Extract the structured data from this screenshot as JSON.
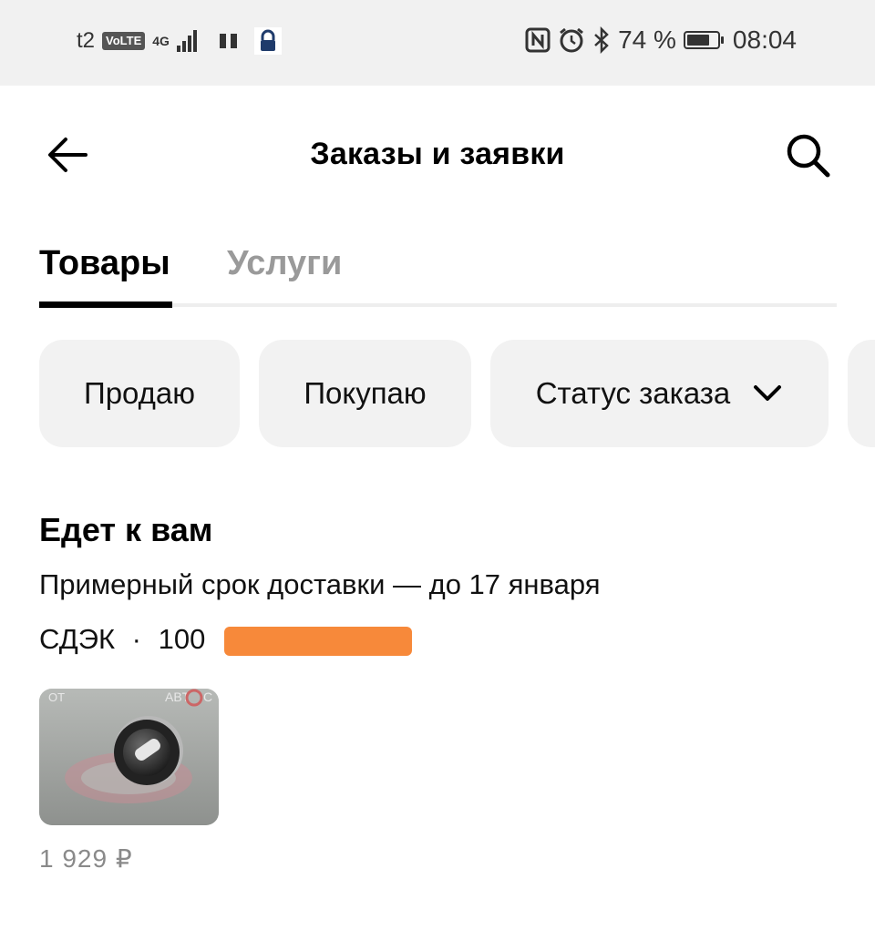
{
  "status_bar": {
    "carrier": "t2",
    "volte": "VoLTE",
    "network": "4G",
    "battery_percent": "74 %",
    "battery_level": 0.74,
    "time": "08:04"
  },
  "header": {
    "title": "Заказы и заявки"
  },
  "tabs": [
    {
      "label": "Товары",
      "active": true
    },
    {
      "label": "Услуги",
      "active": false
    }
  ],
  "filters": {
    "sell": "Продаю",
    "buy": "Покупаю",
    "status": "Статус заказа"
  },
  "order_section": {
    "title": "Едет к вам",
    "delivery_estimate": "Примерный срок доставки — до 17 января",
    "carrier": "СДЭК",
    "separator": "·",
    "tracking_partial": "100",
    "item": {
      "image": "light-switch-knob-photo",
      "price": "1 929 ₽"
    }
  },
  "colors": {
    "redaction": "#f7893a",
    "chip_background": "#f2f2f2",
    "inactive_tab": "#9a9a9a"
  }
}
